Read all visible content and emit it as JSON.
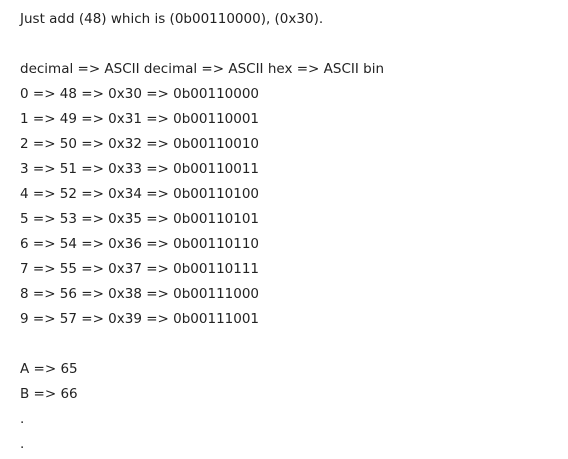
{
  "intro": "Just add (48) which is (0b00110000), (0x30).",
  "table": {
    "header": "decimal => ASCII decimal => ASCII hex => ASCII bin",
    "rows": [
      "0 => 48 => 0x30 => 0b00110000",
      "1 => 49 => 0x31 => 0b00110001",
      "2 => 50 => 0x32 => 0b00110010",
      "3 => 51 => 0x33 => 0b00110011",
      "4 => 52 => 0x34 => 0b00110100",
      "5 => 53 => 0x35 => 0b00110101",
      "6 => 54 => 0x36 => 0b00110110",
      "7 => 55 => 0x37 => 0b00110111",
      "8 => 56 => 0x38 => 0b00111000",
      "9 => 57 => 0x39 => 0b00111001"
    ]
  },
  "letters": {
    "rows": [
      "A => 65",
      "B => 66",
      ".",
      "."
    ]
  }
}
